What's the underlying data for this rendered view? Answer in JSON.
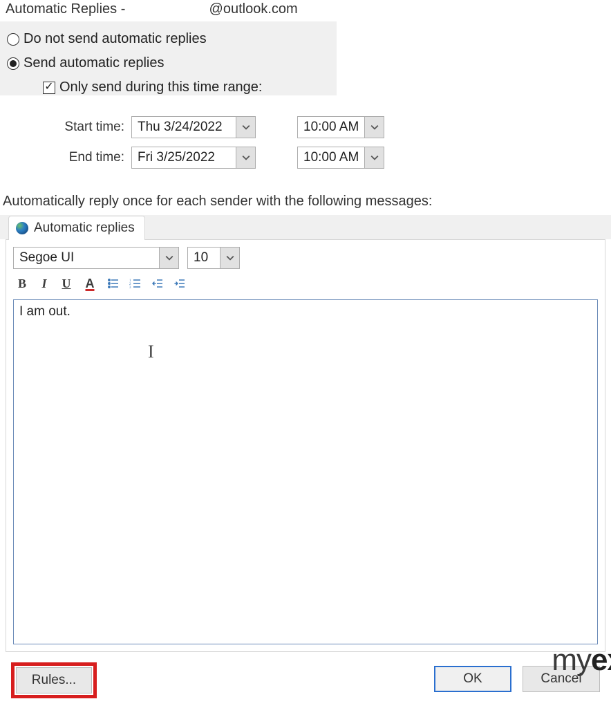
{
  "title": {
    "prefix": "Automatic Replies -",
    "email_domain": "@outlook.com"
  },
  "radio": {
    "do_not_send": "Do not send automatic replies",
    "send": "Send automatic replies"
  },
  "checkbox": {
    "time_range": "Only send during this time range:"
  },
  "labels": {
    "start_time": "Start time:",
    "end_time": "End time:",
    "info": "Automatically reply once for each sender with the following messages:"
  },
  "times": {
    "start_date": "Thu 3/24/2022",
    "start_time": "10:00 AM",
    "end_date": "Fri 3/25/2022",
    "end_time": "10:00 AM"
  },
  "tab": {
    "label": "Automatic replies"
  },
  "editor": {
    "font_name": "Segoe UI",
    "font_size": "10",
    "body": "I am out."
  },
  "buttons": {
    "rules": "Rules...",
    "ok": "OK",
    "cancel": "Cancel"
  },
  "watermark": {
    "part1": "my",
    "part2": "ex"
  }
}
